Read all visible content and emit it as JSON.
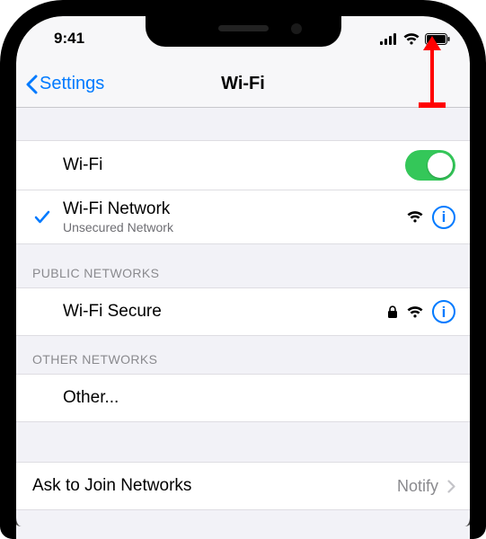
{
  "status_bar": {
    "time": "9:41"
  },
  "nav": {
    "back_label": "Settings",
    "title": "Wi-Fi"
  },
  "wifi_toggle": {
    "label": "Wi-Fi",
    "on": true
  },
  "connected": {
    "name": "Wi-Fi Network",
    "subtitle": "Unsecured Network"
  },
  "sections": {
    "public": {
      "header": "Public Networks",
      "items": [
        {
          "name": "Wi-Fi Secure",
          "locked": true
        }
      ]
    },
    "other": {
      "header": "Other Networks",
      "other_label": "Other..."
    }
  },
  "ask_to_join": {
    "label": "Ask to Join Networks",
    "value": "Notify"
  },
  "icons": {
    "info": "i",
    "lock": "lock-icon"
  }
}
